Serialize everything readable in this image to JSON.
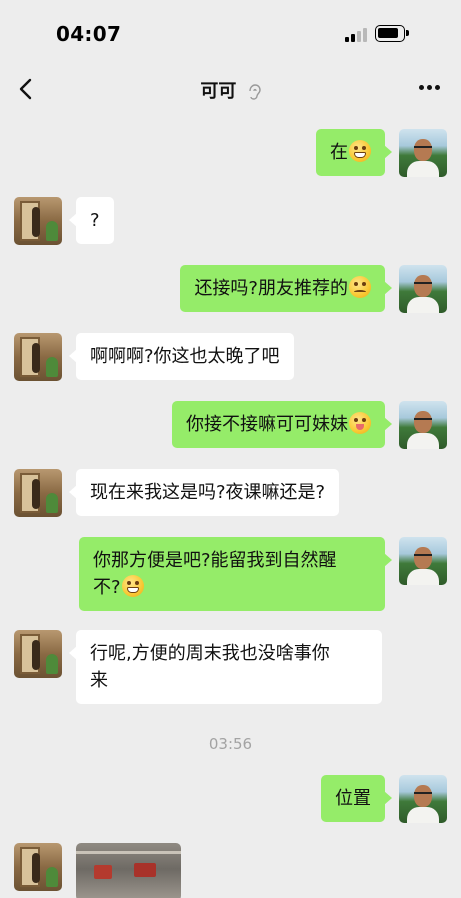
{
  "status": {
    "time": "04:07"
  },
  "nav": {
    "title": "可可"
  },
  "messages": [
    {
      "side": "right",
      "text": "在",
      "emoji": "grin"
    },
    {
      "side": "left",
      "text": "?"
    },
    {
      "side": "right",
      "text": "还接吗?朋友推荐的",
      "emoji": "sad"
    },
    {
      "side": "left",
      "text": "啊啊啊?你这也太晚了吧"
    },
    {
      "side": "right",
      "text": "你接不接嘛可可妹妹",
      "emoji": "tongue"
    },
    {
      "side": "left",
      "text": "现在来我这是吗?夜课嘛还是?"
    },
    {
      "side": "right",
      "text_line1": "你那方便是吧?能留我到自然醒",
      "text_line2": "不?",
      "emoji": "grin"
    },
    {
      "side": "left",
      "text_line1": "行呢,方便的周末我也没啥事你",
      "text_line2": "来"
    },
    {
      "side": "right",
      "text": "位置"
    },
    {
      "side": "left",
      "type": "image"
    }
  ],
  "timestamp": "03:56"
}
